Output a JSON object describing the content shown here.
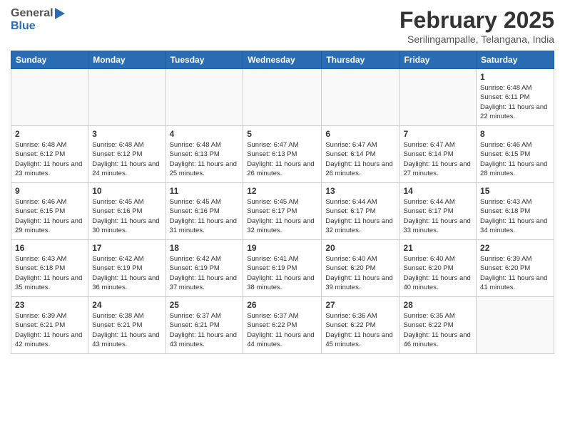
{
  "header": {
    "logo_general": "General",
    "logo_blue": "Blue",
    "month_title": "February 2025",
    "subtitle": "Serilingampalle, Telangana, India"
  },
  "days_of_week": [
    "Sunday",
    "Monday",
    "Tuesday",
    "Wednesday",
    "Thursday",
    "Friday",
    "Saturday"
  ],
  "weeks": [
    [
      {
        "day": "",
        "info": ""
      },
      {
        "day": "",
        "info": ""
      },
      {
        "day": "",
        "info": ""
      },
      {
        "day": "",
        "info": ""
      },
      {
        "day": "",
        "info": ""
      },
      {
        "day": "",
        "info": ""
      },
      {
        "day": "1",
        "info": "Sunrise: 6:48 AM\nSunset: 6:11 PM\nDaylight: 11 hours and 22 minutes."
      }
    ],
    [
      {
        "day": "2",
        "info": "Sunrise: 6:48 AM\nSunset: 6:12 PM\nDaylight: 11 hours and 23 minutes."
      },
      {
        "day": "3",
        "info": "Sunrise: 6:48 AM\nSunset: 6:12 PM\nDaylight: 11 hours and 24 minutes."
      },
      {
        "day": "4",
        "info": "Sunrise: 6:48 AM\nSunset: 6:13 PM\nDaylight: 11 hours and 25 minutes."
      },
      {
        "day": "5",
        "info": "Sunrise: 6:47 AM\nSunset: 6:13 PM\nDaylight: 11 hours and 26 minutes."
      },
      {
        "day": "6",
        "info": "Sunrise: 6:47 AM\nSunset: 6:14 PM\nDaylight: 11 hours and 26 minutes."
      },
      {
        "day": "7",
        "info": "Sunrise: 6:47 AM\nSunset: 6:14 PM\nDaylight: 11 hours and 27 minutes."
      },
      {
        "day": "8",
        "info": "Sunrise: 6:46 AM\nSunset: 6:15 PM\nDaylight: 11 hours and 28 minutes."
      }
    ],
    [
      {
        "day": "9",
        "info": "Sunrise: 6:46 AM\nSunset: 6:15 PM\nDaylight: 11 hours and 29 minutes."
      },
      {
        "day": "10",
        "info": "Sunrise: 6:45 AM\nSunset: 6:16 PM\nDaylight: 11 hours and 30 minutes."
      },
      {
        "day": "11",
        "info": "Sunrise: 6:45 AM\nSunset: 6:16 PM\nDaylight: 11 hours and 31 minutes."
      },
      {
        "day": "12",
        "info": "Sunrise: 6:45 AM\nSunset: 6:17 PM\nDaylight: 11 hours and 32 minutes."
      },
      {
        "day": "13",
        "info": "Sunrise: 6:44 AM\nSunset: 6:17 PM\nDaylight: 11 hours and 32 minutes."
      },
      {
        "day": "14",
        "info": "Sunrise: 6:44 AM\nSunset: 6:17 PM\nDaylight: 11 hours and 33 minutes."
      },
      {
        "day": "15",
        "info": "Sunrise: 6:43 AM\nSunset: 6:18 PM\nDaylight: 11 hours and 34 minutes."
      }
    ],
    [
      {
        "day": "16",
        "info": "Sunrise: 6:43 AM\nSunset: 6:18 PM\nDaylight: 11 hours and 35 minutes."
      },
      {
        "day": "17",
        "info": "Sunrise: 6:42 AM\nSunset: 6:19 PM\nDaylight: 11 hours and 36 minutes."
      },
      {
        "day": "18",
        "info": "Sunrise: 6:42 AM\nSunset: 6:19 PM\nDaylight: 11 hours and 37 minutes."
      },
      {
        "day": "19",
        "info": "Sunrise: 6:41 AM\nSunset: 6:19 PM\nDaylight: 11 hours and 38 minutes."
      },
      {
        "day": "20",
        "info": "Sunrise: 6:40 AM\nSunset: 6:20 PM\nDaylight: 11 hours and 39 minutes."
      },
      {
        "day": "21",
        "info": "Sunrise: 6:40 AM\nSunset: 6:20 PM\nDaylight: 11 hours and 40 minutes."
      },
      {
        "day": "22",
        "info": "Sunrise: 6:39 AM\nSunset: 6:20 PM\nDaylight: 11 hours and 41 minutes."
      }
    ],
    [
      {
        "day": "23",
        "info": "Sunrise: 6:39 AM\nSunset: 6:21 PM\nDaylight: 11 hours and 42 minutes."
      },
      {
        "day": "24",
        "info": "Sunrise: 6:38 AM\nSunset: 6:21 PM\nDaylight: 11 hours and 43 minutes."
      },
      {
        "day": "25",
        "info": "Sunrise: 6:37 AM\nSunset: 6:21 PM\nDaylight: 11 hours and 43 minutes."
      },
      {
        "day": "26",
        "info": "Sunrise: 6:37 AM\nSunset: 6:22 PM\nDaylight: 11 hours and 44 minutes."
      },
      {
        "day": "27",
        "info": "Sunrise: 6:36 AM\nSunset: 6:22 PM\nDaylight: 11 hours and 45 minutes."
      },
      {
        "day": "28",
        "info": "Sunrise: 6:35 AM\nSunset: 6:22 PM\nDaylight: 11 hours and 46 minutes."
      },
      {
        "day": "",
        "info": ""
      }
    ]
  ]
}
